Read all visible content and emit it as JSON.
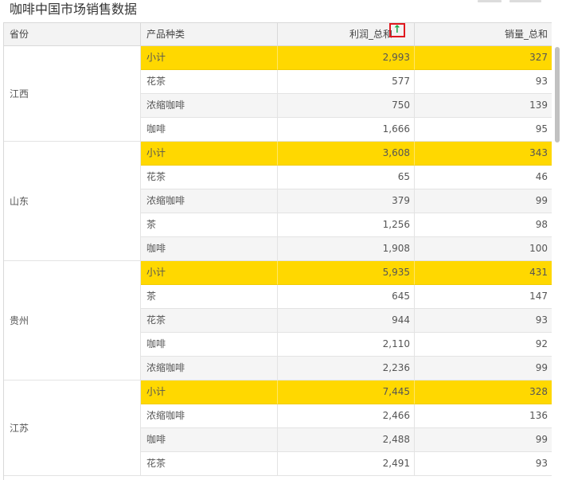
{
  "title": "咖啡中国市场销售数据",
  "colors": {
    "subtotal_bg": "#ffd800",
    "header_bg": "#f3f3f3",
    "alt_row_bg": "#f5f5f5",
    "sort_border": "#e0191f",
    "sort_arrow": "#1aa84a"
  },
  "header": {
    "province": "省份",
    "category": "产品种类",
    "profit": "利润_总和",
    "sales": "销量_总和",
    "sort_icon": "sort-ascending-arrow-icon",
    "sort_glyph": "↑"
  },
  "groups": [
    {
      "province": "江西",
      "rows": [
        {
          "category": "小计",
          "profit": "2,993",
          "sales": "327",
          "subtotal": true
        },
        {
          "category": "花茶",
          "profit": "577",
          "sales": "93"
        },
        {
          "category": "浓缩咖啡",
          "profit": "750",
          "sales": "139"
        },
        {
          "category": "咖啡",
          "profit": "1,666",
          "sales": "95"
        }
      ]
    },
    {
      "province": "山东",
      "rows": [
        {
          "category": "小计",
          "profit": "3,608",
          "sales": "343",
          "subtotal": true
        },
        {
          "category": "花茶",
          "profit": "65",
          "sales": "46"
        },
        {
          "category": "浓缩咖啡",
          "profit": "379",
          "sales": "99"
        },
        {
          "category": "茶",
          "profit": "1,256",
          "sales": "98"
        },
        {
          "category": "咖啡",
          "profit": "1,908",
          "sales": "100"
        }
      ]
    },
    {
      "province": "贵州",
      "rows": [
        {
          "category": "小计",
          "profit": "5,935",
          "sales": "431",
          "subtotal": true
        },
        {
          "category": "茶",
          "profit": "645",
          "sales": "147"
        },
        {
          "category": "花茶",
          "profit": "944",
          "sales": "93"
        },
        {
          "category": "咖啡",
          "profit": "2,110",
          "sales": "92"
        },
        {
          "category": "浓缩咖啡",
          "profit": "2,236",
          "sales": "99"
        }
      ]
    },
    {
      "province": "江苏",
      "rows": [
        {
          "category": "小计",
          "profit": "7,445",
          "sales": "328",
          "subtotal": true
        },
        {
          "category": "浓缩咖啡",
          "profit": "2,466",
          "sales": "136"
        },
        {
          "category": "咖啡",
          "profit": "2,488",
          "sales": "99"
        },
        {
          "category": "花茶",
          "profit": "2,491",
          "sales": "93"
        }
      ]
    }
  ]
}
